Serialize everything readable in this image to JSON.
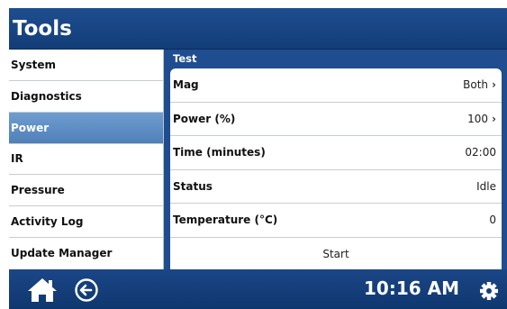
{
  "header": {
    "title": "Tools"
  },
  "sidebar": {
    "items": [
      {
        "label": "System",
        "active": false
      },
      {
        "label": "Diagnostics",
        "active": false
      },
      {
        "label": "Power",
        "active": true
      },
      {
        "label": "IR",
        "active": false
      },
      {
        "label": "Pressure",
        "active": false
      },
      {
        "label": "Activity Log",
        "active": false
      },
      {
        "label": "Update Manager",
        "active": false
      }
    ]
  },
  "panel": {
    "title": "Test",
    "rows": [
      {
        "label": "Mag",
        "value": "Both",
        "chevron": true
      },
      {
        "label": "Power (%)",
        "value": "100",
        "chevron": true
      },
      {
        "label": "Time (minutes)",
        "value": "02:00",
        "chevron": false
      },
      {
        "label": "Status",
        "value": "Idle",
        "chevron": false
      },
      {
        "label": "Temperature (°C)",
        "value": "0",
        "chevron": false
      }
    ],
    "start_label": "Start"
  },
  "footer": {
    "time": "10:16 AM",
    "icons": [
      "home-icon",
      "back-arrow-icon",
      "gear-icon"
    ]
  },
  "colors": {
    "header_blue": "#1f4d8f",
    "active_item": "#5f8fc6",
    "footer_blue": "#123d78"
  }
}
